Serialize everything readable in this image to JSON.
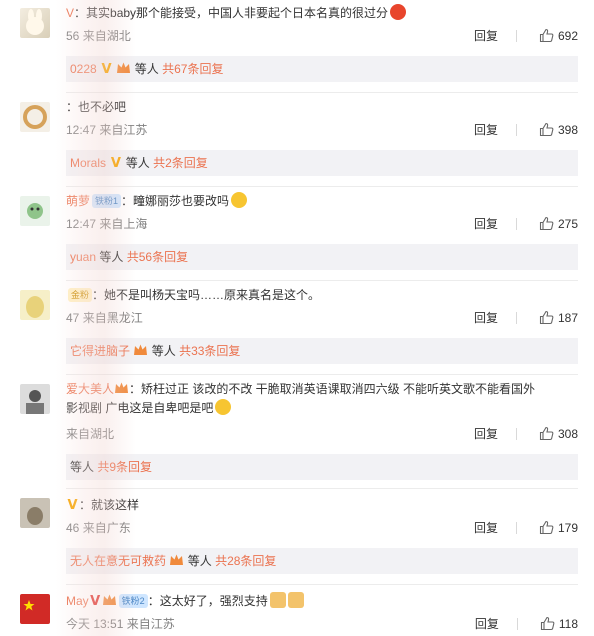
{
  "comments": [
    {
      "username": "V",
      "text": "：其实baby那个能接受，中国人非要起个日本名真的很过分",
      "time": "56",
      "location": "来自湖北",
      "reply_label": "回复",
      "likes": "692",
      "reply_bar": {
        "user": "0228",
        "suffix": "等人",
        "total": "共67条回复"
      }
    },
    {
      "username": "",
      "text": "：也不必吧",
      "time": "12:47",
      "location": "来自江苏",
      "reply_label": "回复",
      "likes": "398",
      "reply_bar": {
        "user": "Morals",
        "suffix": "等人",
        "total": "共2条回复"
      }
    },
    {
      "username": "萌萝",
      "badge": "铁粉1",
      "text": "：疃娜丽莎也要改吗",
      "time": "12:47",
      "location": "来自上海",
      "reply_label": "回复",
      "likes": "275",
      "reply_bar": {
        "user": "yuan",
        "suffix": "等人",
        "total": "共56条回复"
      }
    },
    {
      "username": "",
      "badge": "金粉",
      "text": "：她不是叫杨天宝吗……原来真名是这个。",
      "time": "47",
      "location": "来自黑龙江",
      "reply_label": "回复",
      "likes": "187",
      "reply_bar": {
        "user": "它得进脑子",
        "suffix": "等人",
        "total": "共33条回复"
      }
    },
    {
      "username": "爱大美人",
      "text": "：矫枉过正 该改的不改 干脆取消英语课取消四六级 不能听英文歌不能看国外",
      "text2": "影视剧 广电这是自卑吧是吧",
      "time": "",
      "location": "来自湖北",
      "reply_label": "回复",
      "likes": "308",
      "reply_bar": {
        "user": "",
        "suffix": "等人",
        "total": "共9条回复"
      }
    },
    {
      "username": "",
      "text": "：就该这样",
      "time": "46",
      "location": "来自广东",
      "reply_label": "回复",
      "likes": "179",
      "reply_bar": {
        "user": "无人在意无可救药",
        "suffix": "等人",
        "total": "共28条回复"
      }
    },
    {
      "username": "May",
      "badge": "铁粉2",
      "text": "：这太好了，强烈支持",
      "time": "今天 13:51",
      "location": "来自江苏",
      "reply_label": "回复",
      "likes": "118"
    }
  ],
  "colors": {
    "accent": "#eb7350",
    "vip": "#f7a500",
    "meta": "#808080",
    "reply_bg": "#f2f2f5"
  }
}
